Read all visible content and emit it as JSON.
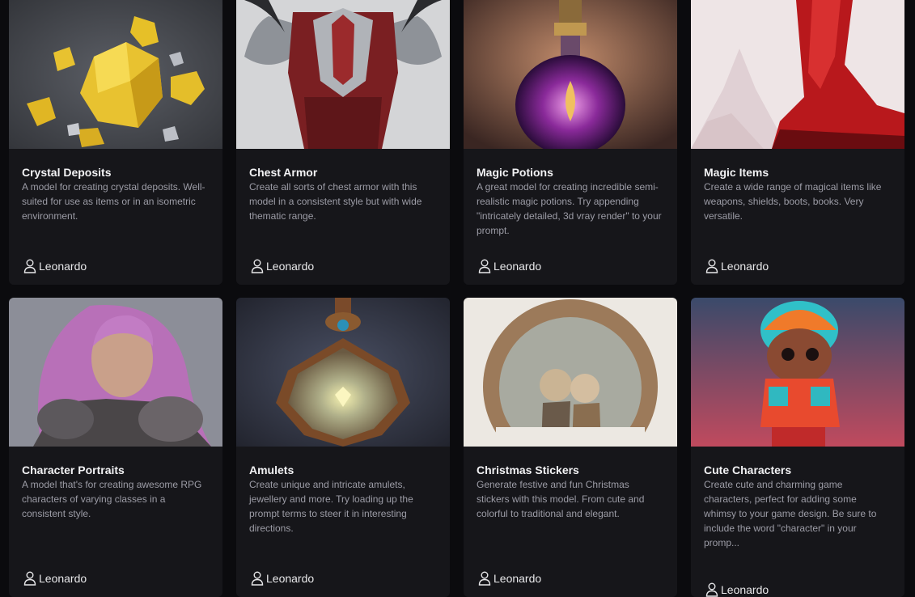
{
  "models": [
    {
      "title": "Crystal Deposits",
      "description": "A model for creating crystal deposits. Well-suited for use as items or in an isometric environment.",
      "author": "Leonardo",
      "icon": "user-icon"
    },
    {
      "title": "Chest Armor",
      "description": "Create all sorts of chest armor with this model in a consistent style but with wide thematic range.",
      "author": "Leonardo",
      "icon": "user-icon"
    },
    {
      "title": "Magic Potions",
      "description": "A great model for creating incredible semi-realistic magic potions. Try appending \"intricately detailed, 3d vray render\" to your prompt.",
      "author": "Leonardo",
      "icon": "user-icon"
    },
    {
      "title": "Magic Items",
      "description": "Create a wide range of magical items like weapons, shields, boots, books. Very versatile.",
      "author": "Leonardo",
      "icon": "user-icon"
    },
    {
      "title": "Character Portraits",
      "description": "A model that's for creating awesome RPG characters of varying classes in a consistent style.",
      "author": "Leonardo",
      "icon": "user-icon"
    },
    {
      "title": "Amulets",
      "description": "Create unique and intricate amulets, jewellery and more. Try loading up the prompt terms to steer it in interesting directions.",
      "author": "Leonardo",
      "icon": "user-icon"
    },
    {
      "title": "Christmas Stickers",
      "description": "Generate festive and fun Christmas stickers with this model. From cute and colorful to traditional and elegant.",
      "author": "Leonardo",
      "icon": "user-icon"
    },
    {
      "title": "Cute Characters",
      "description": "Create cute and charming game characters, perfect for adding some whimsy to your game design. Be sure to include the word \"character\" in your promp...",
      "author": "Leonardo",
      "icon": "user-icon"
    }
  ],
  "colors": {
    "page_bg": "#0b0b0e",
    "card_bg": "#16161a",
    "title": "#f2f2f4",
    "description": "#9c9ca6"
  }
}
